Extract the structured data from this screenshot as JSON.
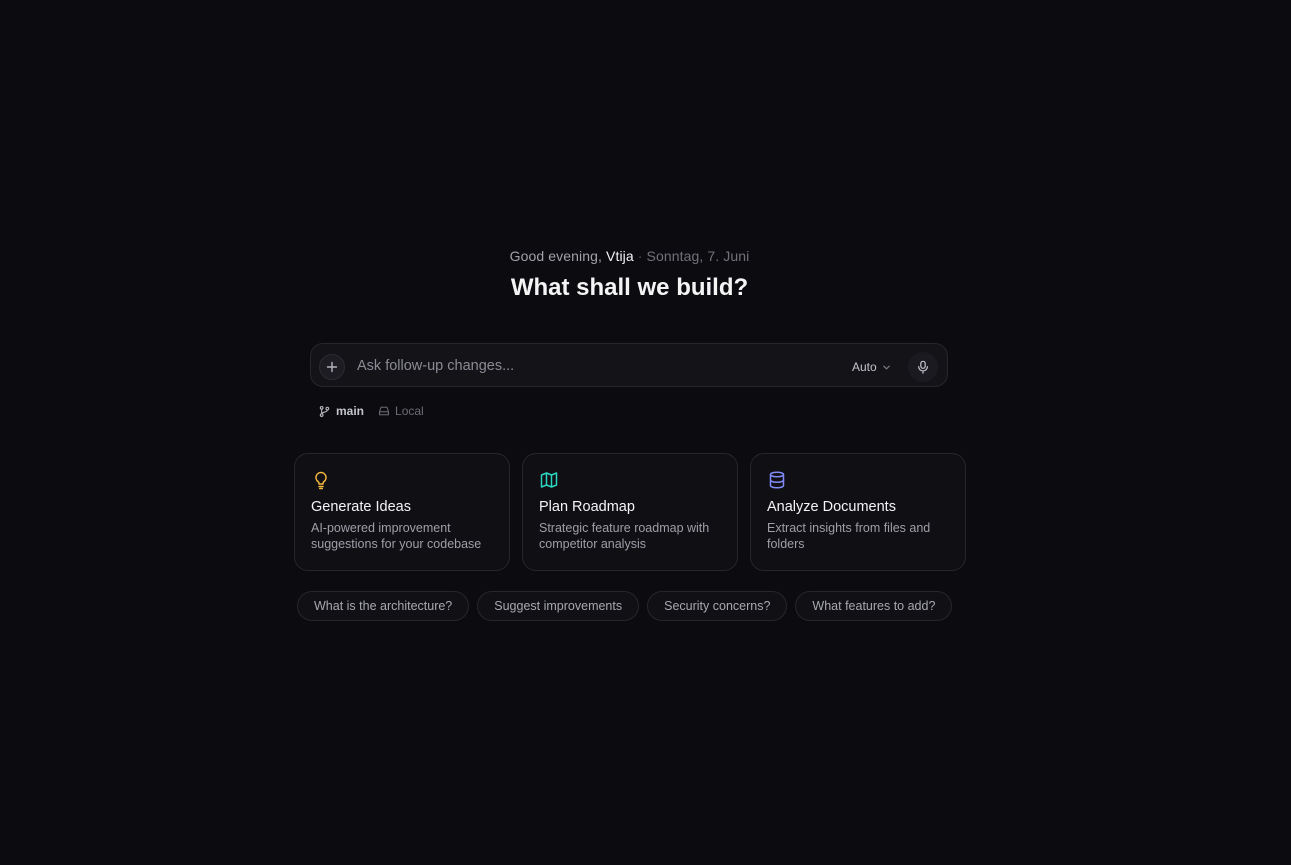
{
  "greeting": {
    "prefix": "Good evening,",
    "name": "Vtija",
    "separator": "·",
    "date": "Sonntag, 7. Juni"
  },
  "headline": "What shall we build?",
  "composer": {
    "placeholder": "Ask follow-up changes...",
    "model": "Auto",
    "icons": {
      "add": "plus-icon",
      "model_dropdown": "chevron-down-icon",
      "mic": "microphone-icon"
    }
  },
  "meta": {
    "branch": "main",
    "location": "Local",
    "icons": {
      "branch": "git-branch-icon",
      "location": "hard-drive-icon"
    }
  },
  "cards": [
    {
      "title": "Generate Ideas",
      "description": "AI-powered improvement suggestions for your codebase",
      "icon": "lightbulb-icon",
      "color": "#f5b83d"
    },
    {
      "title": "Plan Roadmap",
      "description": "Strategic feature roadmap with competitor analysis",
      "icon": "map-icon",
      "color": "#2dd4bf"
    },
    {
      "title": "Analyze Documents",
      "description": "Extract insights from files and folders",
      "icon": "database-icon",
      "color": "#818cf8"
    }
  ],
  "suggestions": [
    "What is the architecture?",
    "Suggest improvements",
    "Security concerns?",
    "What features to add?"
  ],
  "colors": {
    "background": "#0c0c10",
    "surface": "#131318",
    "border": "#26262c",
    "text_primary": "#f4f4f5",
    "text_secondary": "#9f9fa8"
  }
}
